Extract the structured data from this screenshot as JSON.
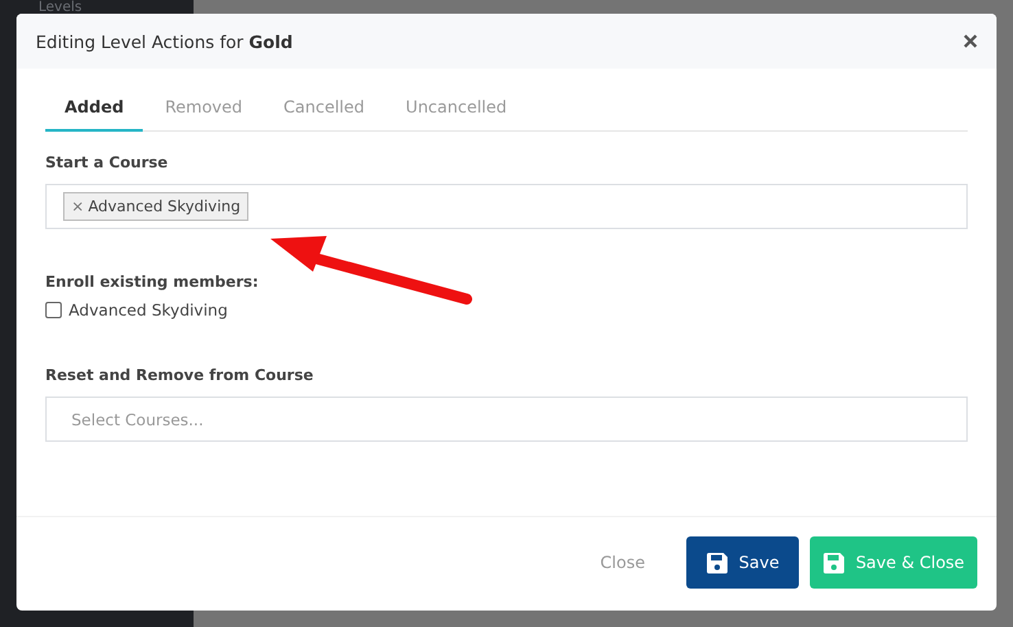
{
  "sidebar": {
    "items": [
      {
        "label": "Levels"
      }
    ]
  },
  "dialog": {
    "title": "Editing Level Actions for **Gold**",
    "tabs": [
      {
        "label": "Added",
        "selected": true
      },
      {
        "label": "Removed",
        "selected": false
      },
      {
        "label": "Cancelled",
        "selected": false
      },
      {
        "label": "Uncancelled",
        "selected": false
      }
    ],
    "start_course": {
      "label": "Start a Course",
      "tags": [
        {
          "remove": "×",
          "label": "Advanced Skydiving"
        }
      ]
    },
    "enroll": {
      "label": "Enroll existing members:",
      "options": [
        {
          "label": "Advanced Skydiving",
          "checked": false
        }
      ]
    },
    "reset_remove": {
      "label": "Reset and Remove from Course",
      "placeholder": "Select Courses..."
    },
    "buttons": [
      {
        "kind": "link",
        "label": "Close"
      },
      {
        "kind": "primary",
        "label": "Save"
      },
      {
        "kind": "success",
        "label": "Save & Close"
      }
    ]
  }
}
